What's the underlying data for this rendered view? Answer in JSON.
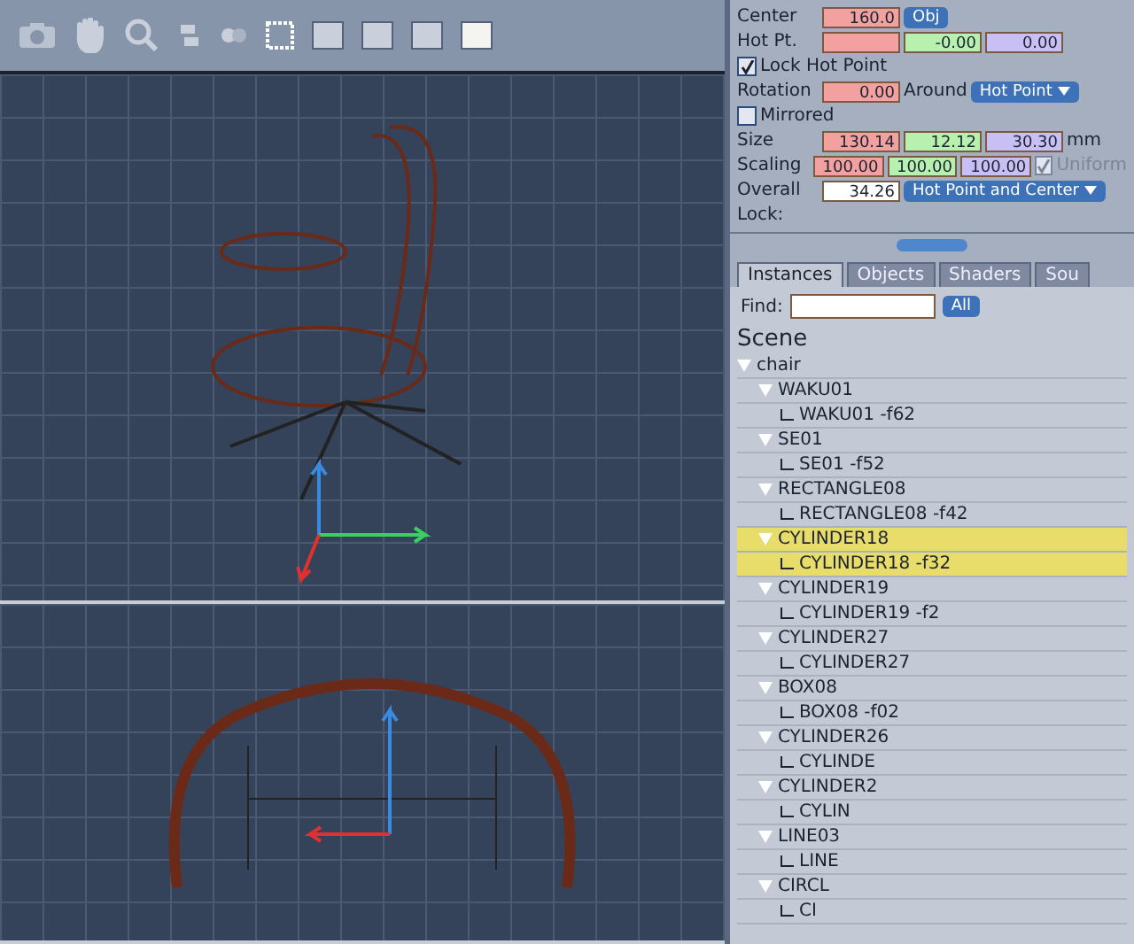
{
  "toolbar": {
    "view_layouts": [
      {
        "selected": false
      },
      {
        "selected": false
      },
      {
        "selected": false
      },
      {
        "selected": true
      }
    ]
  },
  "properties": {
    "center": {
      "label": "Center",
      "value": "160.0",
      "button": "Obj"
    },
    "hot_point": {
      "label": "Hot Pt.",
      "values": [
        "-0.00",
        "0.00"
      ]
    },
    "lock_hot_point": {
      "label": "Lock Hot Point",
      "checked": true
    },
    "rotation": {
      "label": "Rotation",
      "value": "0.00",
      "around_label": "Around",
      "around": "Hot Point"
    },
    "mirrored": {
      "label": "Mirrored",
      "checked": false
    },
    "size": {
      "label": "Size",
      "values": [
        "130.14",
        "12.12",
        "30.30"
      ],
      "unit": "mm"
    },
    "scaling": {
      "label": "Scaling",
      "values": [
        "100.00",
        "100.00",
        "100.00"
      ],
      "uniform": {
        "label": "Uniform",
        "checked": true,
        "disabled": true
      }
    },
    "overall": {
      "label": "Overall",
      "value": "34.26",
      "lock_mode": "Hot Point and Center"
    },
    "lock": {
      "label": "Lock:"
    }
  },
  "browser": {
    "tabs": [
      {
        "label": "Instances",
        "selected": true
      },
      {
        "label": "Objects",
        "selected": false
      },
      {
        "label": "Shaders",
        "selected": false
      },
      {
        "label": "Sou",
        "selected": false
      }
    ],
    "find": {
      "label": "Find:"
    },
    "filter": "All",
    "heading": "Scene",
    "tree": [
      {
        "label": "chair",
        "expanded": true,
        "selected": false,
        "children": [
          {
            "label": "WAKU01",
            "expanded": true,
            "selected": false,
            "children": [
              {
                "label": "WAKU01 -f62",
                "selected": false
              }
            ]
          },
          {
            "label": "SE01",
            "expanded": true,
            "selected": false,
            "children": [
              {
                "label": "SE01 -f52",
                "selected": false
              }
            ]
          },
          {
            "label": "RECTANGLE08",
            "expanded": true,
            "selected": false,
            "children": [
              {
                "label": "RECTANGLE08 -f42",
                "selected": false
              }
            ]
          },
          {
            "label": "CYLINDER18",
            "expanded": true,
            "selected": true,
            "children": [
              {
                "label": "CYLINDER18 -f32",
                "selected": true
              }
            ]
          },
          {
            "label": "CYLINDER19",
            "expanded": true,
            "selected": false,
            "children": [
              {
                "label": "CYLINDER19 -f2",
                "selected": false
              }
            ]
          },
          {
            "label": "CYLINDER27",
            "expanded": true,
            "selected": false,
            "children": [
              {
                "label": "CYLINDER27",
                "selected": false
              }
            ]
          },
          {
            "label": "BOX08",
            "expanded": true,
            "selected": false,
            "children": [
              {
                "label": "BOX08 -f02",
                "selected": false
              }
            ]
          },
          {
            "label": "CYLINDER26",
            "expanded": true,
            "selected": false,
            "children": [
              {
                "label": "CYLINDE",
                "selected": false
              }
            ]
          },
          {
            "label": "CYLINDER2",
            "expanded": true,
            "selected": false,
            "children": [
              {
                "label": "CYLIN",
                "selected": false
              }
            ]
          },
          {
            "label": "LINE03",
            "expanded": true,
            "selected": false,
            "children": [
              {
                "label": "LINE",
                "selected": false
              }
            ]
          },
          {
            "label": "CIRCL",
            "expanded": true,
            "selected": false,
            "children": [
              {
                "label": "CI",
                "selected": false
              }
            ]
          }
        ]
      }
    ]
  }
}
